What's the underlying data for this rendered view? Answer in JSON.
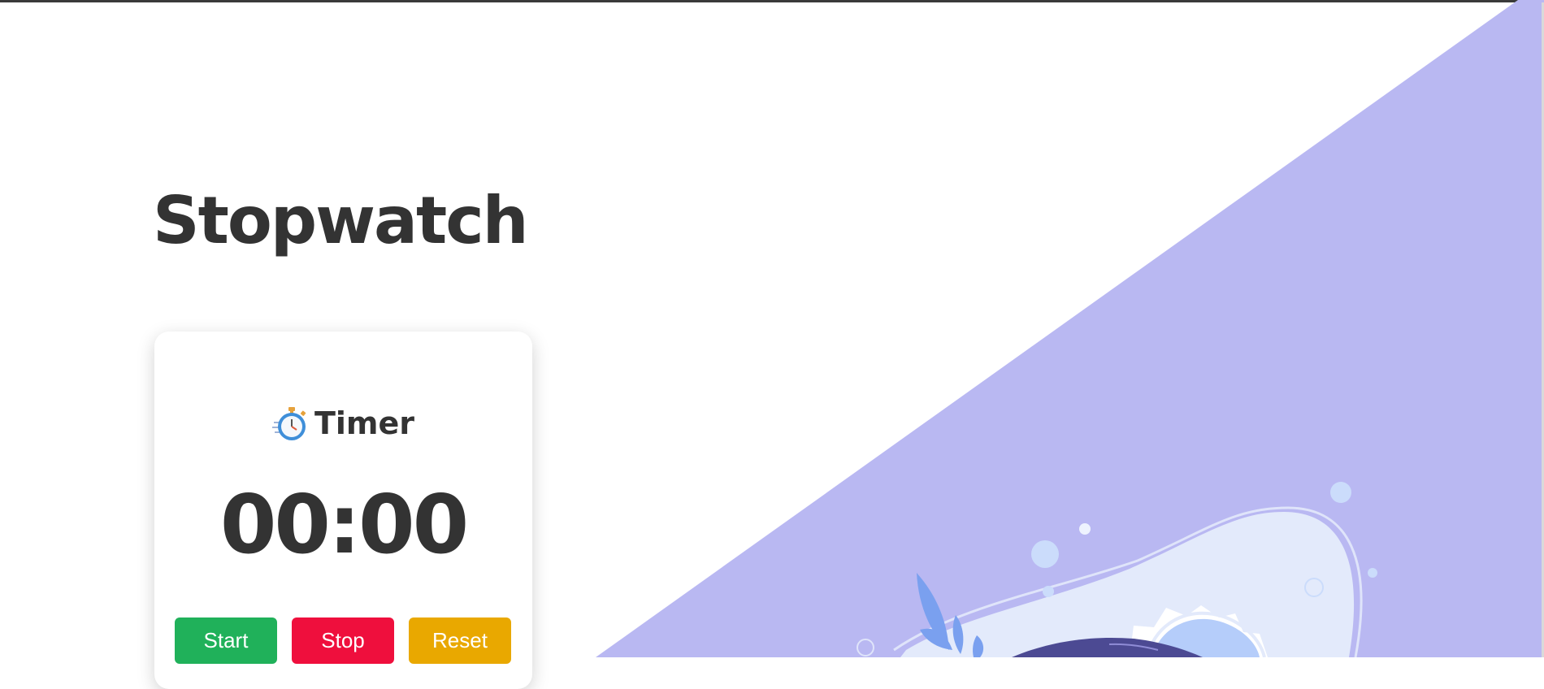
{
  "page": {
    "title": "Stopwatch"
  },
  "timer": {
    "icon": "stopwatch-icon",
    "title": "Timer",
    "display": "00:00"
  },
  "buttons": {
    "start": "Start",
    "stop": "Stop",
    "reset": "Reset"
  },
  "colors": {
    "background": "#ffffff",
    "text": "#333333",
    "accent_triangle": "#b9b8f2",
    "start": "#20b15a",
    "stop": "#ef0f3d",
    "reset": "#e9a800"
  }
}
